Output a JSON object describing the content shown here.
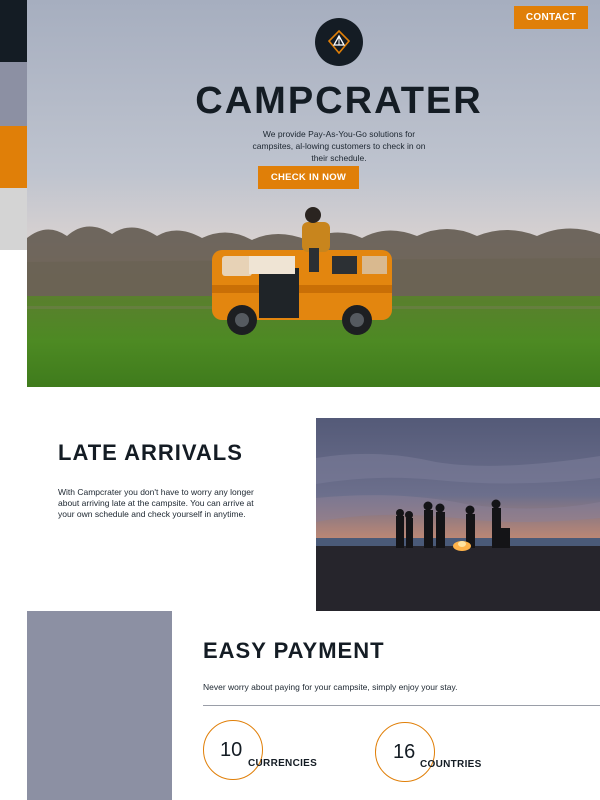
{
  "colors": {
    "accent": "#e07f08",
    "dark": "#141c24",
    "slate": "#8c90a3",
    "light_gray": "#d4d4d4"
  },
  "header": {
    "logo_icon": "tent-pin-icon",
    "contact_label": "CONTACT"
  },
  "hero": {
    "title": "CAMPCRATER",
    "subtitle": "We provide Pay-As-You-Go solutions for campsites, al-lowing customers to check in on their schedule.",
    "cta_label": "CHECK IN NOW"
  },
  "late_arrivals": {
    "title": "LATE ARRIVALS",
    "text": "With Campcrater you don't have to worry any longer about arriving late at the campsite. You can arrive at your own schedule and check yourself in anytime."
  },
  "easy_payment": {
    "title": "EASY PAYMENT",
    "text": "Never worry about paying for your campsite, simply enjoy your stay.",
    "stats": [
      {
        "value": "10",
        "label": "CURRENCIES"
      },
      {
        "value": "16",
        "label": "COUNTRIES"
      }
    ]
  }
}
